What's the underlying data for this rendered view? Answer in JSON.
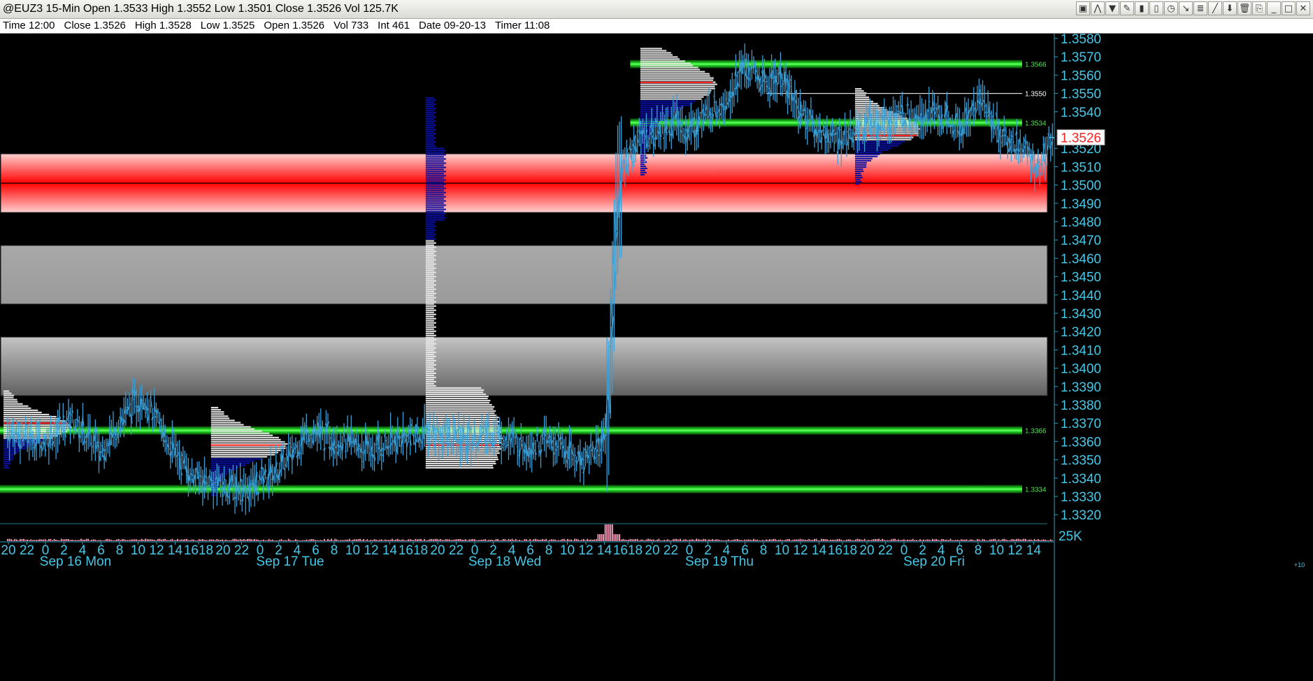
{
  "window": {
    "title": "@EUZ3 15-Min Open 1.3533 High 1.3552 Low 1.3501 Close 1.3526 Vol 125.7K",
    "toolbar_icons": [
      "chart-type-icon",
      "drawing-icon",
      "indicator-icon",
      "pencil-icon",
      "bar-icon",
      "candle-icon",
      "clock-icon",
      "cursor-icon",
      "fib-icon",
      "line-tool-icon",
      "arrow-down-icon",
      "trash-icon",
      "link-icon",
      "minimize-icon",
      "maximize-icon",
      "close-icon"
    ],
    "toolbar_glyphs": [
      "▣",
      "⋀",
      "▼",
      "✎",
      "▮",
      "▯",
      "◷",
      "↘",
      "≣",
      "╱",
      "⬇",
      "🗑",
      "⎘",
      "_",
      "□",
      "✕"
    ]
  },
  "info_bar": {
    "time": "Time 12:00",
    "close": "Close 1.3526",
    "high": "High 1.3528",
    "low": "Low 1.3525",
    "open": "Open 1.3526",
    "vol": "Vol 733",
    "int": "Int 461",
    "date": "Date 09-20-13",
    "timer": "Timer 11:08"
  },
  "colors": {
    "background": "#000000",
    "price_bars": "#3a9fd6",
    "axis_text": "#45c8e8",
    "support_resistance": "#00ff00",
    "red_zone": "#ff0000",
    "gray_zone": "#a0a0a0",
    "profile_blue": "#0a0fa0",
    "profile_white": "#e8e8e8",
    "poc": "#ff2020",
    "volume_bars": "#ff9fbf",
    "last_price_tag": "#ff2020"
  },
  "chart_data": {
    "type": "candlestick",
    "symbol": "@EUZ3",
    "interval": "15-Min",
    "ylim": [
      1.3315,
      1.3585
    ],
    "y_ticks": [
      "1.3580",
      "1.3570",
      "1.3560",
      "1.3550",
      "1.3540",
      "1.3520",
      "1.3510",
      "1.3500",
      "1.3490",
      "1.3480",
      "1.3470",
      "1.3460",
      "1.3450",
      "1.3440",
      "1.3430",
      "1.3420",
      "1.3410",
      "1.3400",
      "1.3390",
      "1.3380",
      "1.3370",
      "1.3360",
      "1.3350",
      "1.3340",
      "1.3330",
      "1.3320"
    ],
    "last_price": "1.3526",
    "volume_axis_label": "25K",
    "volume_axis_sublabel": "+10",
    "x_hour_labels": [
      "20",
      "22",
      "0",
      "2",
      "4",
      "6",
      "8",
      "10",
      "12",
      "14",
      "1618",
      "20",
      "22",
      "0",
      "2",
      "4",
      "6",
      "8",
      "10",
      "12",
      "14",
      "1618",
      "20",
      "22",
      "0",
      "2",
      "4",
      "6",
      "8",
      "10",
      "12",
      "14",
      "1618",
      "20",
      "22",
      "0",
      "2",
      "4",
      "6",
      "8",
      "10",
      "12",
      "14",
      "1618",
      "20",
      "22",
      "0",
      "2",
      "4",
      "6",
      "8",
      "10",
      "12",
      "14"
    ],
    "x_day_labels": [
      "Sep 16 Mon",
      "Sep 17 Tue",
      "Sep 18 Wed",
      "Sep 19 Thu",
      "Sep 20 Fri"
    ],
    "levels": [
      {
        "price": 1.3566,
        "label": "1.3566",
        "color": "green",
        "from_slot": 87
      },
      {
        "price": 1.355,
        "label": "1.3550",
        "color": "white",
        "from_slot": 106
      },
      {
        "price": 1.3534,
        "label": "1.3534",
        "color": "green",
        "from_slot": 87
      },
      {
        "price": 1.3366,
        "label": "1.3366",
        "color": "green",
        "from_slot": 0
      },
      {
        "price": 1.3334,
        "label": "1.3334",
        "color": "green",
        "from_slot": 0
      }
    ],
    "zones": [
      {
        "type": "red",
        "from": 1.3485,
        "to": 1.3517,
        "mid": 1.3501
      },
      {
        "type": "gray",
        "from": 1.3435,
        "to": 1.3467
      },
      {
        "type": "gray-dark",
        "from": 1.3385,
        "to": 1.3417
      }
    ],
    "profiles": [
      {
        "start_slot": 0,
        "low": 1.3345,
        "high": 1.3388,
        "peak": 1.3368,
        "width": 88,
        "poc": 1.337
      },
      {
        "start_slot": 29,
        "low": 1.333,
        "high": 1.3379,
        "peak": 1.3358,
        "width": 100,
        "poc": 1.3358
      },
      {
        "start_slot": 59,
        "low": 1.3345,
        "high": 1.3548,
        "peak": 1.3362,
        "width": 100,
        "poc": 1.3358
      },
      {
        "start_slot": 89,
        "low": 1.3505,
        "high": 1.3575,
        "peak": 1.3555,
        "width": 100,
        "poc": 1.3556
      },
      {
        "start_slot": 119,
        "low": 1.35,
        "high": 1.3553,
        "peak": 1.353,
        "width": 85,
        "poc": 1.3527
      }
    ],
    "ohlc_anchors": [
      [
        0,
        1.3365
      ],
      [
        5,
        1.336
      ],
      [
        9,
        1.3372
      ],
      [
        13,
        1.3355
      ],
      [
        17,
        1.3378
      ],
      [
        19,
        1.3385
      ],
      [
        22,
        1.3362
      ],
      [
        26,
        1.334
      ],
      [
        30,
        1.3336
      ],
      [
        34,
        1.3335
      ],
      [
        38,
        1.3345
      ],
      [
        42,
        1.3366
      ],
      [
        47,
        1.336
      ],
      [
        51,
        1.3355
      ],
      [
        55,
        1.3362
      ],
      [
        59,
        1.3365
      ],
      [
        64,
        1.336
      ],
      [
        68,
        1.3365
      ],
      [
        72,
        1.3358
      ],
      [
        76,
        1.336
      ],
      [
        80,
        1.335
      ],
      [
        83,
        1.3358
      ],
      [
        84,
        1.338
      ],
      [
        85,
        1.348
      ],
      [
        86,
        1.351
      ],
      [
        88,
        1.3525
      ],
      [
        91,
        1.353
      ],
      [
        93,
        1.3535
      ],
      [
        95,
        1.353
      ],
      [
        100,
        1.3545
      ],
      [
        103,
        1.3565
      ],
      [
        106,
        1.3555
      ],
      [
        108,
        1.356
      ],
      [
        110,
        1.3545
      ],
      [
        113,
        1.353
      ],
      [
        116,
        1.3525
      ],
      [
        120,
        1.3532
      ],
      [
        125,
        1.3538
      ],
      [
        129,
        1.354
      ],
      [
        133,
        1.353
      ],
      [
        136,
        1.3548
      ],
      [
        139,
        1.3525
      ],
      [
        142,
        1.352
      ],
      [
        144,
        1.3508
      ],
      [
        146,
        1.3526
      ]
    ],
    "volume_spike_slot": 84
  }
}
